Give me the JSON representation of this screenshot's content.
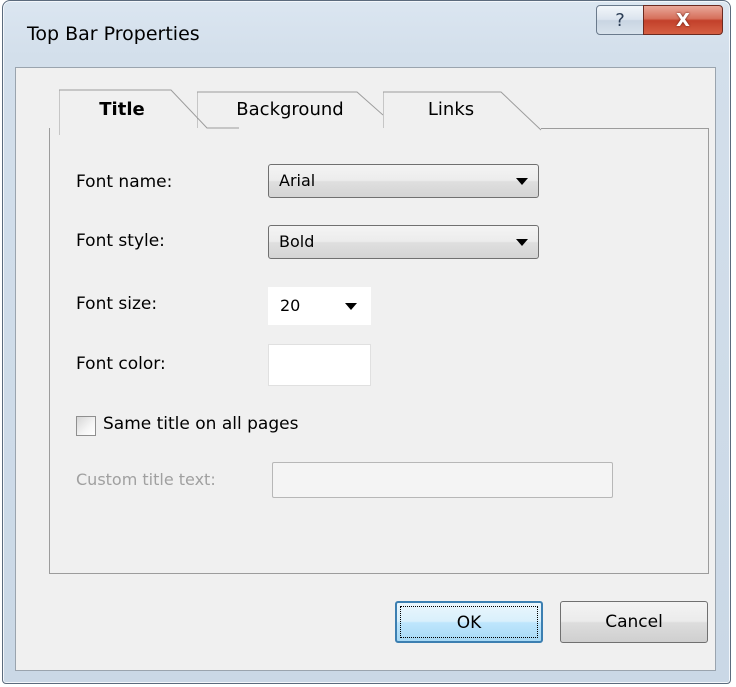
{
  "window": {
    "title": "Top Bar Properties",
    "help_glyph": "?",
    "close_glyph": "X"
  },
  "tabs": [
    {
      "label": "Title",
      "selected": true
    },
    {
      "label": "Background",
      "selected": false
    },
    {
      "label": "Links",
      "selected": false
    }
  ],
  "form": {
    "font_name_label": "Font name:",
    "font_name_value": "Arial",
    "font_style_label": "Font style:",
    "font_style_value": "Bold",
    "font_size_label": "Font size:",
    "font_size_value": "20",
    "font_color_label": "Font color:",
    "font_color_value": "#ffffff",
    "same_title_label": "Same title on all pages",
    "same_title_checked": false,
    "custom_title_label": "Custom title text:",
    "custom_title_value": ""
  },
  "buttons": {
    "ok": "OK",
    "cancel": "Cancel"
  },
  "icons": {
    "help": "question-mark-icon",
    "close": "close-x-icon",
    "dropdown": "dropdown-arrow-icon"
  }
}
